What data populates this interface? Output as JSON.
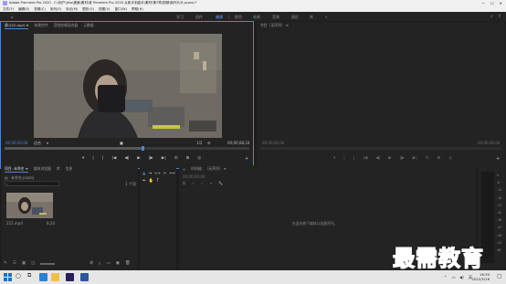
{
  "window": {
    "title": "Adobe Premiere Pro 2020 - C:\\用户\\Jiho\\桌面\\素材\\某 Premiere Pro 2020 从新手到高手\\素材\\第7章\\视频\\制作片头.prproj *",
    "minimize": "—",
    "maximize": "☐",
    "close": "✕"
  },
  "menu": [
    "文件(F)",
    "编辑(E)",
    "剪辑(C)",
    "序列(S)",
    "标记(M)",
    "图形(G)",
    "视图(V)",
    "窗口(W)",
    "帮助(H)"
  ],
  "workspaces": {
    "items": [
      "学习",
      "组件",
      "编辑",
      "颜色",
      "效果",
      "音频",
      "图形",
      "库"
    ],
    "active": "编辑",
    "more": "»"
  },
  "source_panel": {
    "tabs": [
      "源:222.mp4 ≡",
      "效果控件",
      "音频剪辑混合器",
      "元数据"
    ],
    "timecode_in": "00;00;00;00",
    "fit": "适合",
    "quality": "1/2",
    "duration": "00;00;08;24"
  },
  "program_panel": {
    "tab": "节目（无序列） ≡",
    "timecode_in": "00;00;00;00",
    "timecode_out": "00;00;00;00"
  },
  "project_panel": {
    "tabs": [
      "项目: 未命名 ≡",
      "媒体浏览器",
      "库",
      "信息"
    ],
    "project_file": "未命名.prproj",
    "item_count": "1 个项",
    "clip_name": "222.mp4",
    "clip_duration": "8;24"
  },
  "timeline_panel": {
    "tab": "时间轴：（无序列） ≡",
    "timecode": "00;00;00;00",
    "empty_hint": "在此处放下媒体以创建序列。"
  },
  "audio_meter": {
    "db_labels": [
      "0",
      "-6",
      "-12",
      "-18",
      "-24",
      "-30",
      "-36",
      "-42",
      "-48",
      "-54",
      "dB"
    ]
  },
  "taskbar": {
    "time": "16:30",
    "date": "2022/5/16",
    "lang": "英"
  },
  "watermark": "最需教育",
  "colors": {
    "accent": "#4a86d4",
    "panel_bg": "#232323",
    "app_bg": "#1d1d1d"
  }
}
